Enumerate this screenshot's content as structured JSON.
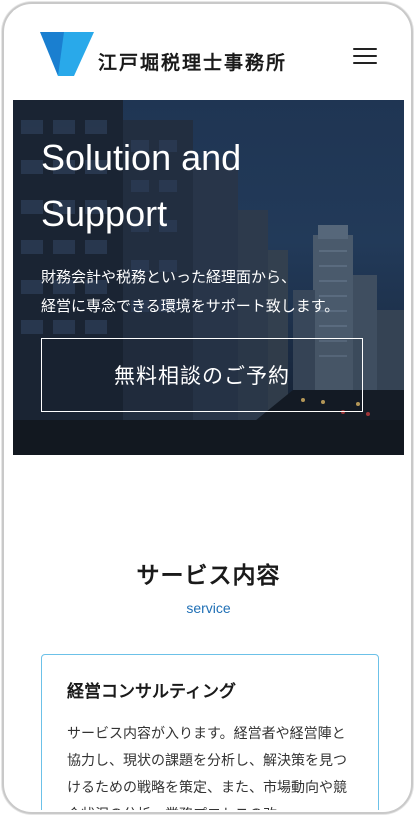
{
  "header": {
    "site_name": "江戸堀税理士事務所",
    "menu_icon": "hamburger-icon",
    "brand_color": "#1ea0e0"
  },
  "hero": {
    "title_line1": "Solution and",
    "title_line2": "Support",
    "text_line1": "財務会計や税務といった経理面から、",
    "text_line2": "経営に専念できる環境をサポート致します。",
    "cta_label": "無料相談のご予約"
  },
  "services": {
    "title": "サービス内容",
    "subtitle": "service",
    "accent": "#1f6fb5",
    "card": {
      "title": "経営コンサルティング",
      "text": "サービス内容が入ります。経営者や経営陣と協力し、現状の課題を分析し、解決策を見つけるための戦略を策定、また、市場動向や競合状況の分析、業務プロセスの改"
    }
  }
}
